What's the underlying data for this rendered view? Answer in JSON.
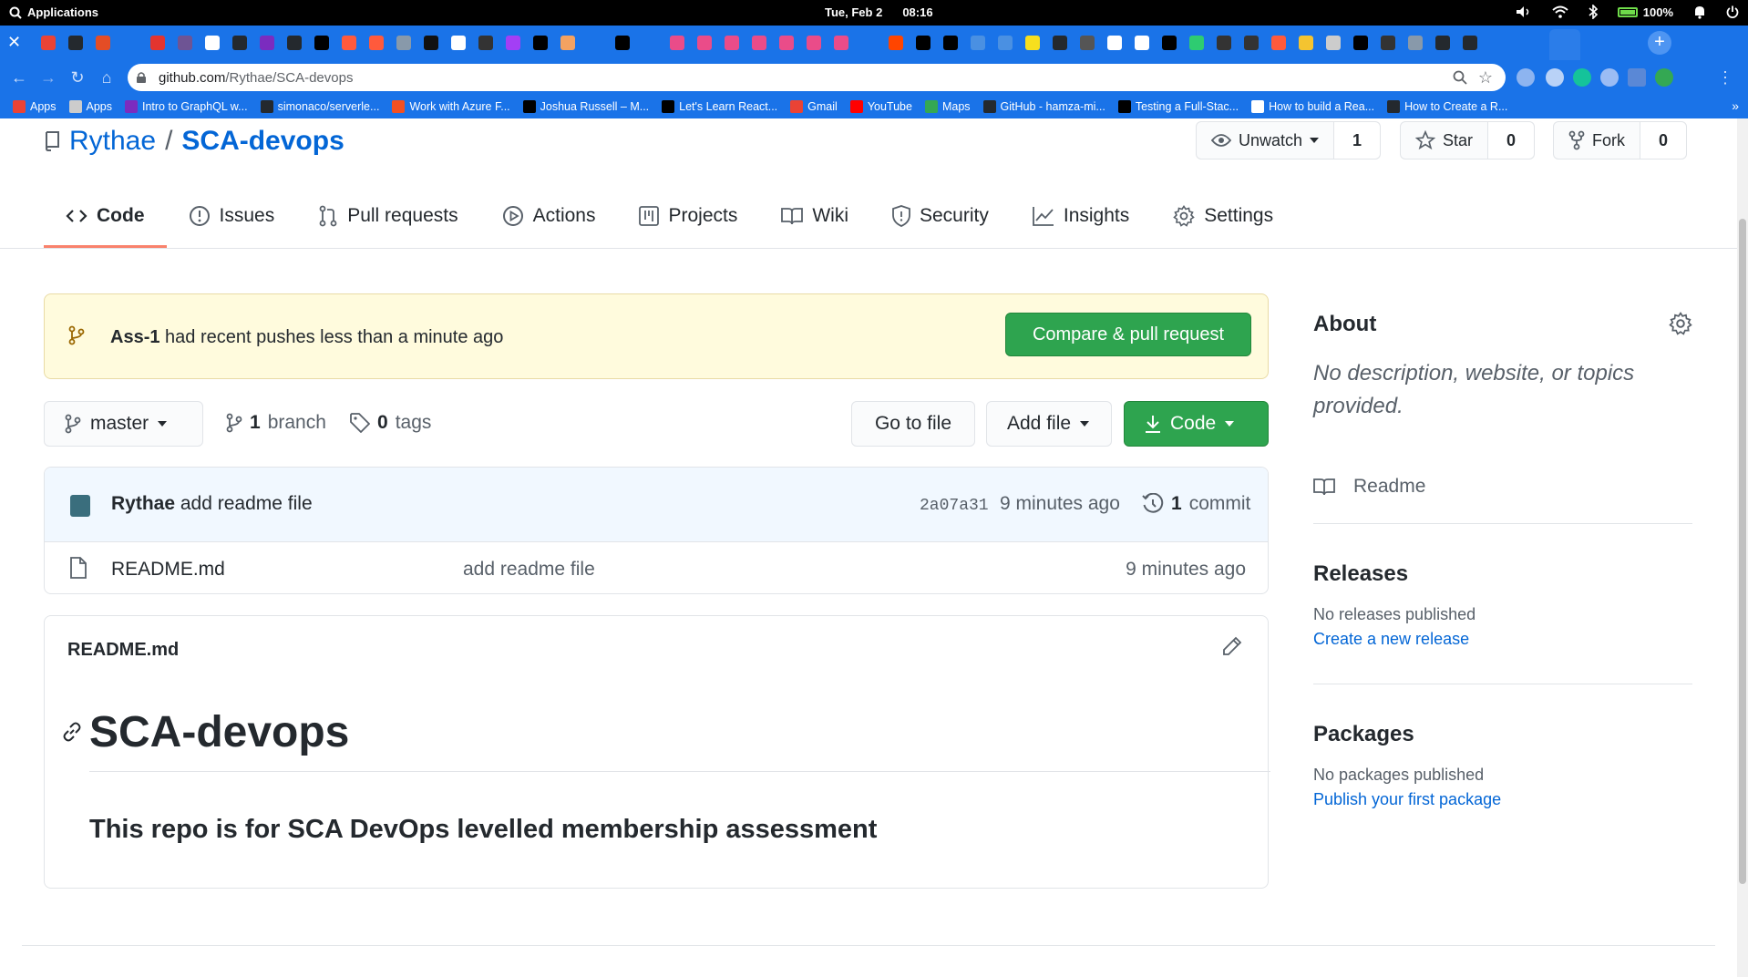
{
  "os": {
    "applications": "Applications",
    "date": "Tue, Feb  2",
    "time": "08:16",
    "battery": "100%"
  },
  "tabs": {
    "favicon_colors": [
      "#ea4335",
      "#24292e",
      "#e44d26",
      "#1a73e8",
      "#e3342f",
      "#6e5494",
      "#ffffff",
      "#24292e",
      "#7b2cbf",
      "#24292e",
      "#000000",
      "#ff5a3c",
      "#ff5a3c",
      "#8899aa",
      "#111111",
      "#ffffff",
      "#333333",
      "#a33ff5",
      "#000000",
      "#f4a261",
      "#1a73e8",
      "#000000",
      "#1a73e8",
      "#ea4c89",
      "#ea4c89",
      "#ea4c89",
      "#ea4c89",
      "#ea4c89",
      "#ea4c89",
      "#ea4c89",
      "#1a73e8",
      "#ff4500",
      "#000000",
      "#000000",
      "#4a90e2",
      "#4a90e2",
      "#f7df1e",
      "#24292e",
      "#555555",
      "#ffffff",
      "#ffffff",
      "#000000",
      "#2ecc71",
      "#333333",
      "#333333",
      "#ff5a3c",
      "#f4c430",
      "#cccccc",
      "#000000",
      "#333333",
      "#8899aa",
      "#24292e",
      "#24292e"
    ]
  },
  "address": {
    "url_host": "github.com",
    "url_path": "/Rythae/SCA-devops"
  },
  "bookmarks": [
    {
      "label": "Apps",
      "color": "#ea4335"
    },
    {
      "label": "Apps",
      "color": "#cccccc"
    },
    {
      "label": "Intro to GraphQL w...",
      "color": "#7b2cbf"
    },
    {
      "label": "simonaco/serverle...",
      "color": "#24292e"
    },
    {
      "label": "Work with Azure F...",
      "color": "#f25022"
    },
    {
      "label": "Joshua Russell – M...",
      "color": "#000000"
    },
    {
      "label": "Let's Learn React...",
      "color": "#000000"
    },
    {
      "label": "Gmail",
      "color": "#ea4335"
    },
    {
      "label": "YouTube",
      "color": "#ff0000"
    },
    {
      "label": "Maps",
      "color": "#34a853"
    },
    {
      "label": "GitHub - hamza-mi...",
      "color": "#24292e"
    },
    {
      "label": "Testing a Full-Stac...",
      "color": "#000000"
    },
    {
      "label": "How to build a Rea...",
      "color": "#ffffff"
    },
    {
      "label": "How to Create a R...",
      "color": "#24292e"
    }
  ],
  "repo": {
    "owner": "Rythae",
    "separator": "/",
    "name": "SCA-devops",
    "watch_label": "Unwatch",
    "watch_count": "1",
    "star_label": "Star",
    "star_count": "0",
    "fork_label": "Fork",
    "fork_count": "0"
  },
  "nav": {
    "code": "Code",
    "issues": "Issues",
    "pulls": "Pull requests",
    "actions": "Actions",
    "projects": "Projects",
    "wiki": "Wiki",
    "security": "Security",
    "insights": "Insights",
    "settings": "Settings"
  },
  "flash": {
    "branch": "Ass-1",
    "message": " had recent pushes less than a minute ago",
    "button": "Compare & pull request"
  },
  "toolbar": {
    "branch": "master",
    "branch_count": "1",
    "branch_word": "branch",
    "tag_count": "0",
    "tag_word": "tags",
    "go_to_file": "Go to file",
    "add_file": "Add file",
    "code": "Code"
  },
  "commit": {
    "author": "Rythae",
    "message": "add readme file",
    "sha": "2a07a31",
    "age": "9 minutes ago",
    "count": "1",
    "count_word": "commit"
  },
  "files": [
    {
      "name": "README.md",
      "message": "add readme file",
      "age": "9 minutes ago"
    }
  ],
  "readme": {
    "title": "README.md",
    "h1": "SCA-devops",
    "h3": "This repo is for SCA DevOps levelled membership assessment"
  },
  "sidebar": {
    "about_title": "About",
    "about_desc": "No description, website, or topics provided.",
    "readme_link": "Readme",
    "releases_title": "Releases",
    "releases_empty": "No releases published",
    "releases_link": "Create a new release",
    "packages_title": "Packages",
    "packages_empty": "No packages published",
    "packages_link": "Publish your first package"
  },
  "colors": {
    "accent_blue": "#0366d6",
    "green_button": "#2ea44f",
    "flash_bg": "#fffbdd",
    "nav_underline": "#f9826c",
    "chrome_blue": "#1a73e8"
  }
}
